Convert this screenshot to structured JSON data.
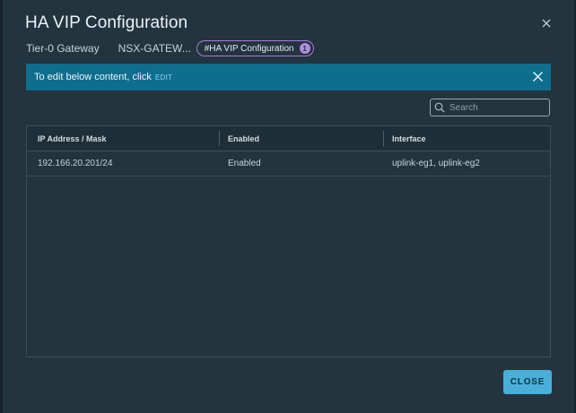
{
  "dialog": {
    "title": "HA VIP Configuration",
    "close_icon": "close-icon"
  },
  "breadcrumb": {
    "items": [
      "Tier-0 Gateway",
      "NSX-GATEW..."
    ],
    "chip_label": "#HA VIP Configuration",
    "chip_count": "1"
  },
  "banner": {
    "text": "To edit below content, click",
    "link": "EDIT",
    "close_icon": "close-icon"
  },
  "search": {
    "placeholder": "Search",
    "value": "",
    "icon": "search-icon"
  },
  "table": {
    "columns": [
      "IP Address / Mask",
      "Enabled",
      "Interface"
    ],
    "rows": [
      [
        "192.166.20.201/24",
        "Enabled",
        "uplink-eg1, uplink-eg2"
      ]
    ]
  },
  "footer": {
    "close_label": "CLOSE"
  },
  "colors": {
    "background": "#22343e",
    "banner": "#0f6d8e",
    "primary_button": "#49afd9",
    "chip_border": "#a77cd6"
  }
}
